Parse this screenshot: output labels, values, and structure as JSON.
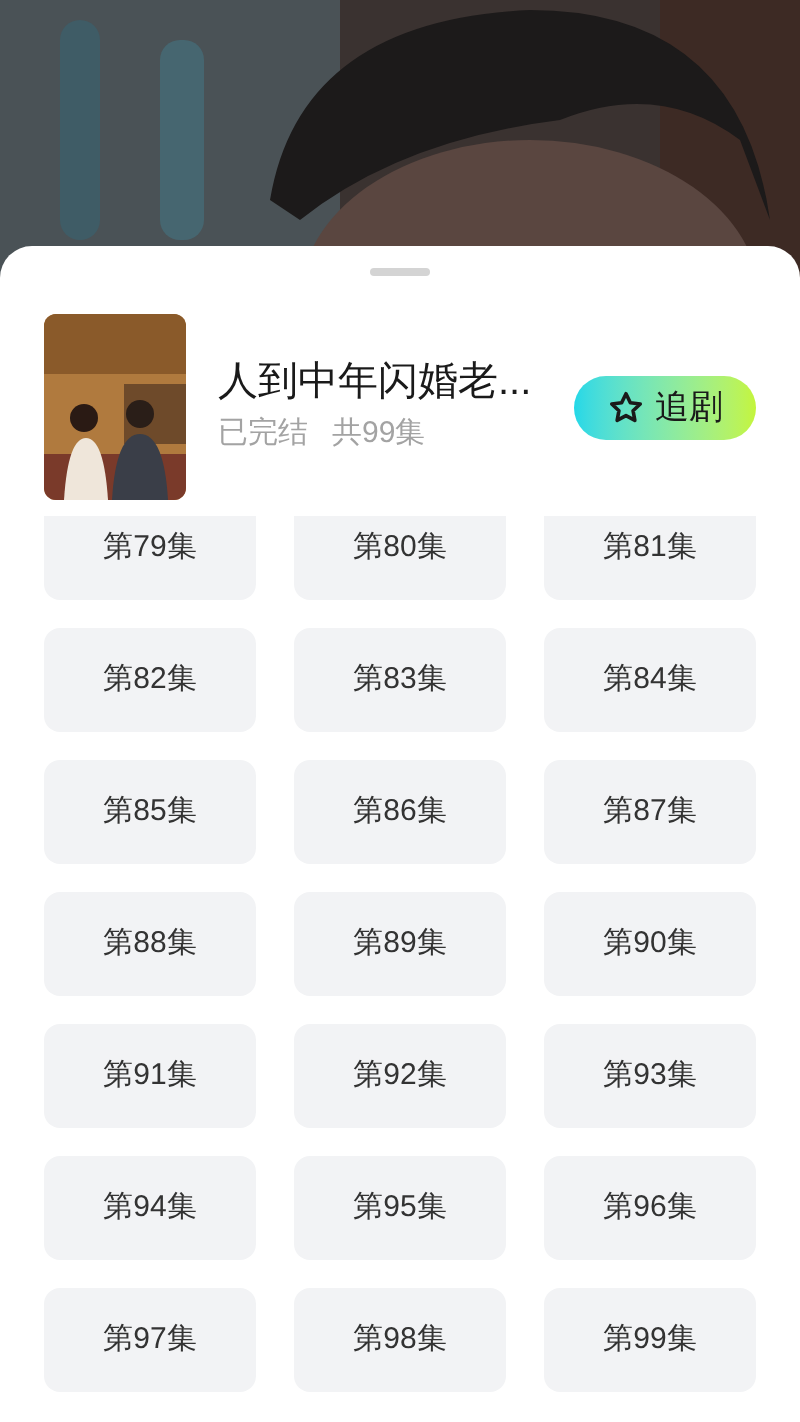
{
  "drama": {
    "title": "人到中年闪婚老...",
    "status": "已完结",
    "count": "共99集",
    "follow_button": "追剧"
  },
  "episodes": [
    "第79集",
    "第80集",
    "第81集",
    "第82集",
    "第83集",
    "第84集",
    "第85集",
    "第86集",
    "第87集",
    "第88集",
    "第89集",
    "第90集",
    "第91集",
    "第92集",
    "第93集",
    "第94集",
    "第95集",
    "第96集",
    "第97集",
    "第98集",
    "第99集"
  ]
}
